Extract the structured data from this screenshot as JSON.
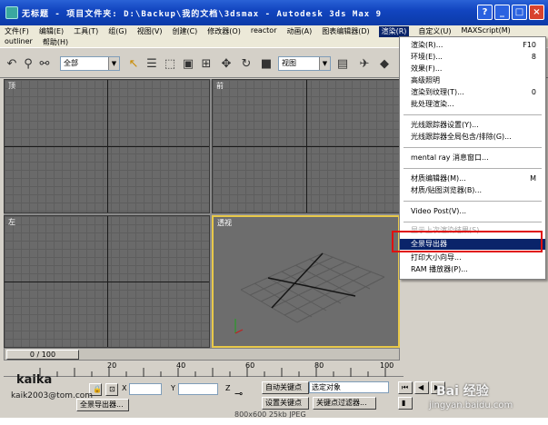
{
  "window": {
    "title": "无标题   - 项目文件夹: D:\\Backup\\我的文档\\3dsmax    - Autodesk 3ds Max 9",
    "buttons": {
      "help": "?",
      "minimize": "_",
      "maximize": "□",
      "close": "×"
    }
  },
  "menubar": {
    "row1": [
      "文件(F)",
      "编辑(E)",
      "工具(T)",
      "组(G)",
      "视图(V)",
      "创建(C)",
      "修改器(O)",
      "reactor",
      "动画(A)",
      "图表编辑器(D)",
      "渲染(R)",
      "自定义(U)",
      "MAXScript(M)"
    ],
    "row2": [
      "outliner",
      "帮助(H)"
    ],
    "active_index": 10
  },
  "toolbar": {
    "selection_filter": "全部",
    "coord_system": "视图"
  },
  "viewports": {
    "top": "顶",
    "front": "前",
    "left": "左",
    "perspective": "透视"
  },
  "timeline": {
    "frame": "0 / 100",
    "ticks": [
      "20",
      "40",
      "60",
      "80",
      "100"
    ]
  },
  "status": {
    "x_label": "X",
    "y_label": "Y",
    "z_label": "Z",
    "auto_key": "自动关键点",
    "set_key": "设置关键点",
    "selected_obj": "选定对象",
    "key_filters": "关键点过滤器...",
    "panorama": "全景导出器...",
    "image_info": "800x600  25kb  JPEG"
  },
  "render_menu": {
    "items": [
      {
        "label": "渲染(R)...",
        "shortcut": "F10"
      },
      {
        "label": "环境(E)...",
        "shortcut": "8"
      },
      {
        "label": "效果(F)..."
      },
      {
        "label": "高级照明"
      },
      {
        "label": "渲染到纹理(T)...",
        "shortcut": "0"
      },
      {
        "label": "批处理渲染..."
      },
      {
        "label": "光线跟踪器设置(Y)..."
      },
      {
        "label": "光线跟踪器全局包含/排除(G)..."
      },
      {
        "label": "mental ray 消息窗口..."
      },
      {
        "label": "材质编辑器(M)...",
        "shortcut": "M"
      },
      {
        "label": "材质/贴图浏览器(B)..."
      },
      {
        "label": "Video Post(V)..."
      },
      {
        "label": "显示上次渲染结果(S)..."
      },
      {
        "label": "全景导出器"
      },
      {
        "label": "打印大小向导..."
      },
      {
        "label": "RAM 播放器(P)..."
      }
    ]
  },
  "watermark": {
    "brand": "kaika",
    "email": "kaik2003@tom.com",
    "site": "Bai 经验",
    "url": "jingyan.baidu.com"
  },
  "colors": {
    "title_bar": "#1245c0",
    "highlight": "#0a246a",
    "viewport_active": "#e8c84a",
    "annotation_red": "#e01010"
  }
}
